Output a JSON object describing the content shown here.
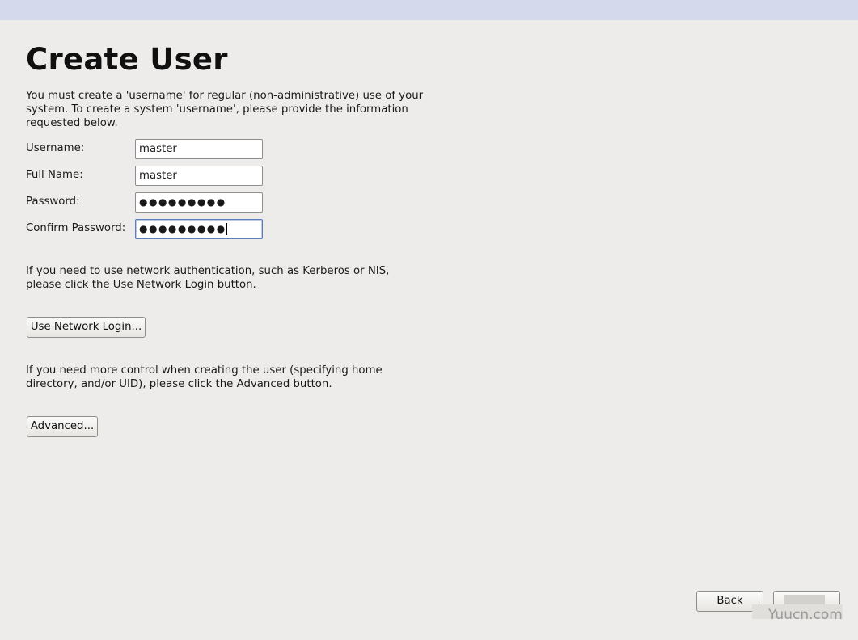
{
  "page": {
    "title": "Create User",
    "intro_text": "You must create a 'username' for regular (non-administrative) use of your\nsystem.  To create a system 'username', please provide the information\nrequested below."
  },
  "form": {
    "username": {
      "label": "Username:",
      "value": "master"
    },
    "full_name": {
      "label": "Full Name:",
      "value": "master"
    },
    "password": {
      "label": "Password:",
      "value": "●●●●●●●●●"
    },
    "confirm_password": {
      "label": "Confirm Password:",
      "value": "●●●●●●●●●"
    }
  },
  "network": {
    "text": "If you need to use network authentication, such as Kerberos or NIS,\nplease click the Use Network Login button.",
    "button_label": "Use Network Login..."
  },
  "advanced": {
    "text": "If you need more control when creating the user (specifying home\ndirectory, and/or UID), please click the Advanced button.",
    "button_label": "Advanced..."
  },
  "footer": {
    "back_label": "Back",
    "next_label": "",
    "watermark": "Yuucn.com"
  },
  "colors": {
    "background": "#edecea",
    "top_strip": "#d4d9ec",
    "focus_border": "#5a7fbf"
  }
}
